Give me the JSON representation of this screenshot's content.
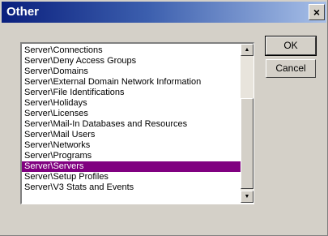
{
  "dialog": {
    "title": "Other",
    "close_glyph": "×",
    "ok_label": "OK",
    "cancel_label": "Cancel"
  },
  "list": {
    "selected_index": 13,
    "items": [
      "Server\\Connections",
      "Server\\Deny Access Groups",
      "Server\\Domains",
      "Server\\External Domain Network Information",
      "Server\\File Identifications",
      "Server\\Holidays",
      "Server\\Licenses",
      "Server\\Mail-In Databases and Resources",
      "Server\\Mail Users",
      "Server\\Networks",
      "Server\\Programs",
      "Server\\Servers",
      "Server\\Setup Profiles",
      "Server\\V3 Stats and Events"
    ]
  },
  "scrollbar": {
    "up_glyph": "▲",
    "down_glyph": "▼"
  },
  "icons": [
    "close-icon",
    "scroll-up-arrow-icon",
    "scroll-down-arrow-icon"
  ]
}
